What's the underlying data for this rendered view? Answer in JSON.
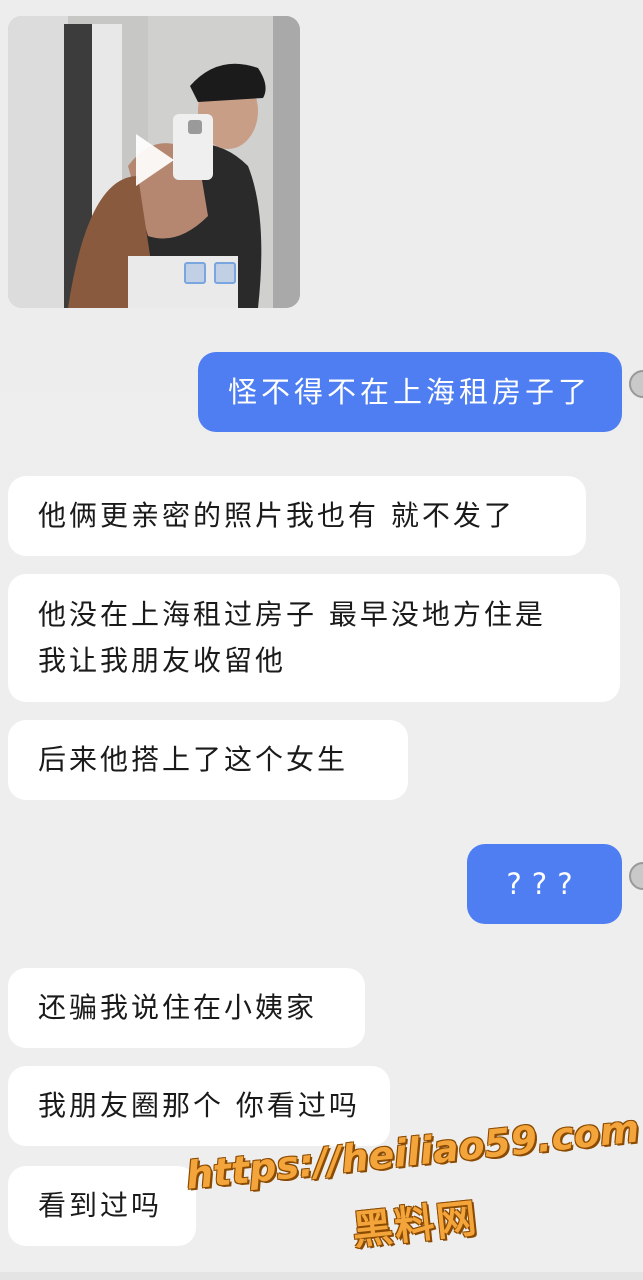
{
  "messages": [
    {
      "side": "in",
      "text": "他俩更亲密的照片我也有  就不发了"
    },
    {
      "side": "in",
      "lines": [
        "他没在上海租过房子  最早没地方住是",
        "我让我朋友收留他"
      ]
    },
    {
      "side": "in",
      "text": "后来他搭上了这个女生"
    },
    {
      "side": "out",
      "text": "???"
    },
    {
      "side": "in",
      "text": "还骗我说住在小姨家"
    },
    {
      "side": "in",
      "text": "我朋友圈那个  你看过吗"
    },
    {
      "side": "in",
      "text": "看到过吗"
    }
  ],
  "out_first": "怪不得不在上海租房子了",
  "photo": {
    "type": "video-thumbnail",
    "icon": "play-icon"
  },
  "watermark": {
    "url": "https://heiliao59.com",
    "name": "黑料网"
  },
  "colors": {
    "background": "#ededee",
    "incoming": "#ffffff",
    "outgoing": "#4e7ef1"
  }
}
